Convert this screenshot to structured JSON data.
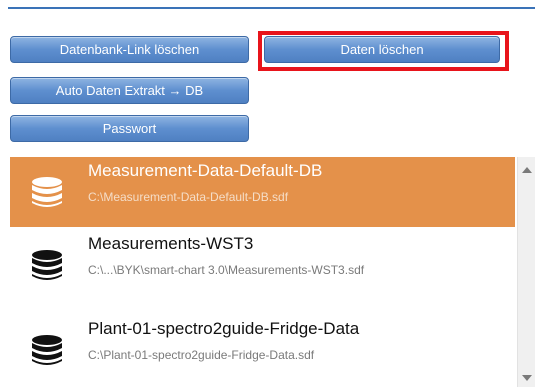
{
  "toolbar": {
    "delete_db_link_label": "Datenbank-Link löschen",
    "delete_data_label": "Daten löschen",
    "auto_extract_label": "Auto Daten Extrakt → DB",
    "password_label": "Passwort"
  },
  "db_list": {
    "items": [
      {
        "name": "Measurement-Data-Default-DB",
        "path": "C:\\Measurement-Data-Default-DB.sdf",
        "selected": true
      },
      {
        "name": "Measurements-WST3",
        "path": "C:\\...\\BYK\\smart-chart 3.0\\Measurements-WST3.sdf",
        "selected": false
      },
      {
        "name": "Plant-01-spectro2guide-Fridge-Data",
        "path": "C:\\Plant-01-spectro2guide-Fridge-Data.sdf",
        "selected": false
      }
    ]
  },
  "colors": {
    "accent": "#3a73b8",
    "selected_row": "#e4914a",
    "highlight_frame": "#e8141b",
    "button_bg": "#5e8fcf"
  },
  "icons": {
    "db_icon": "database-icon",
    "scroll_up": "chevron-up-icon",
    "scroll_down": "chevron-down-icon"
  }
}
